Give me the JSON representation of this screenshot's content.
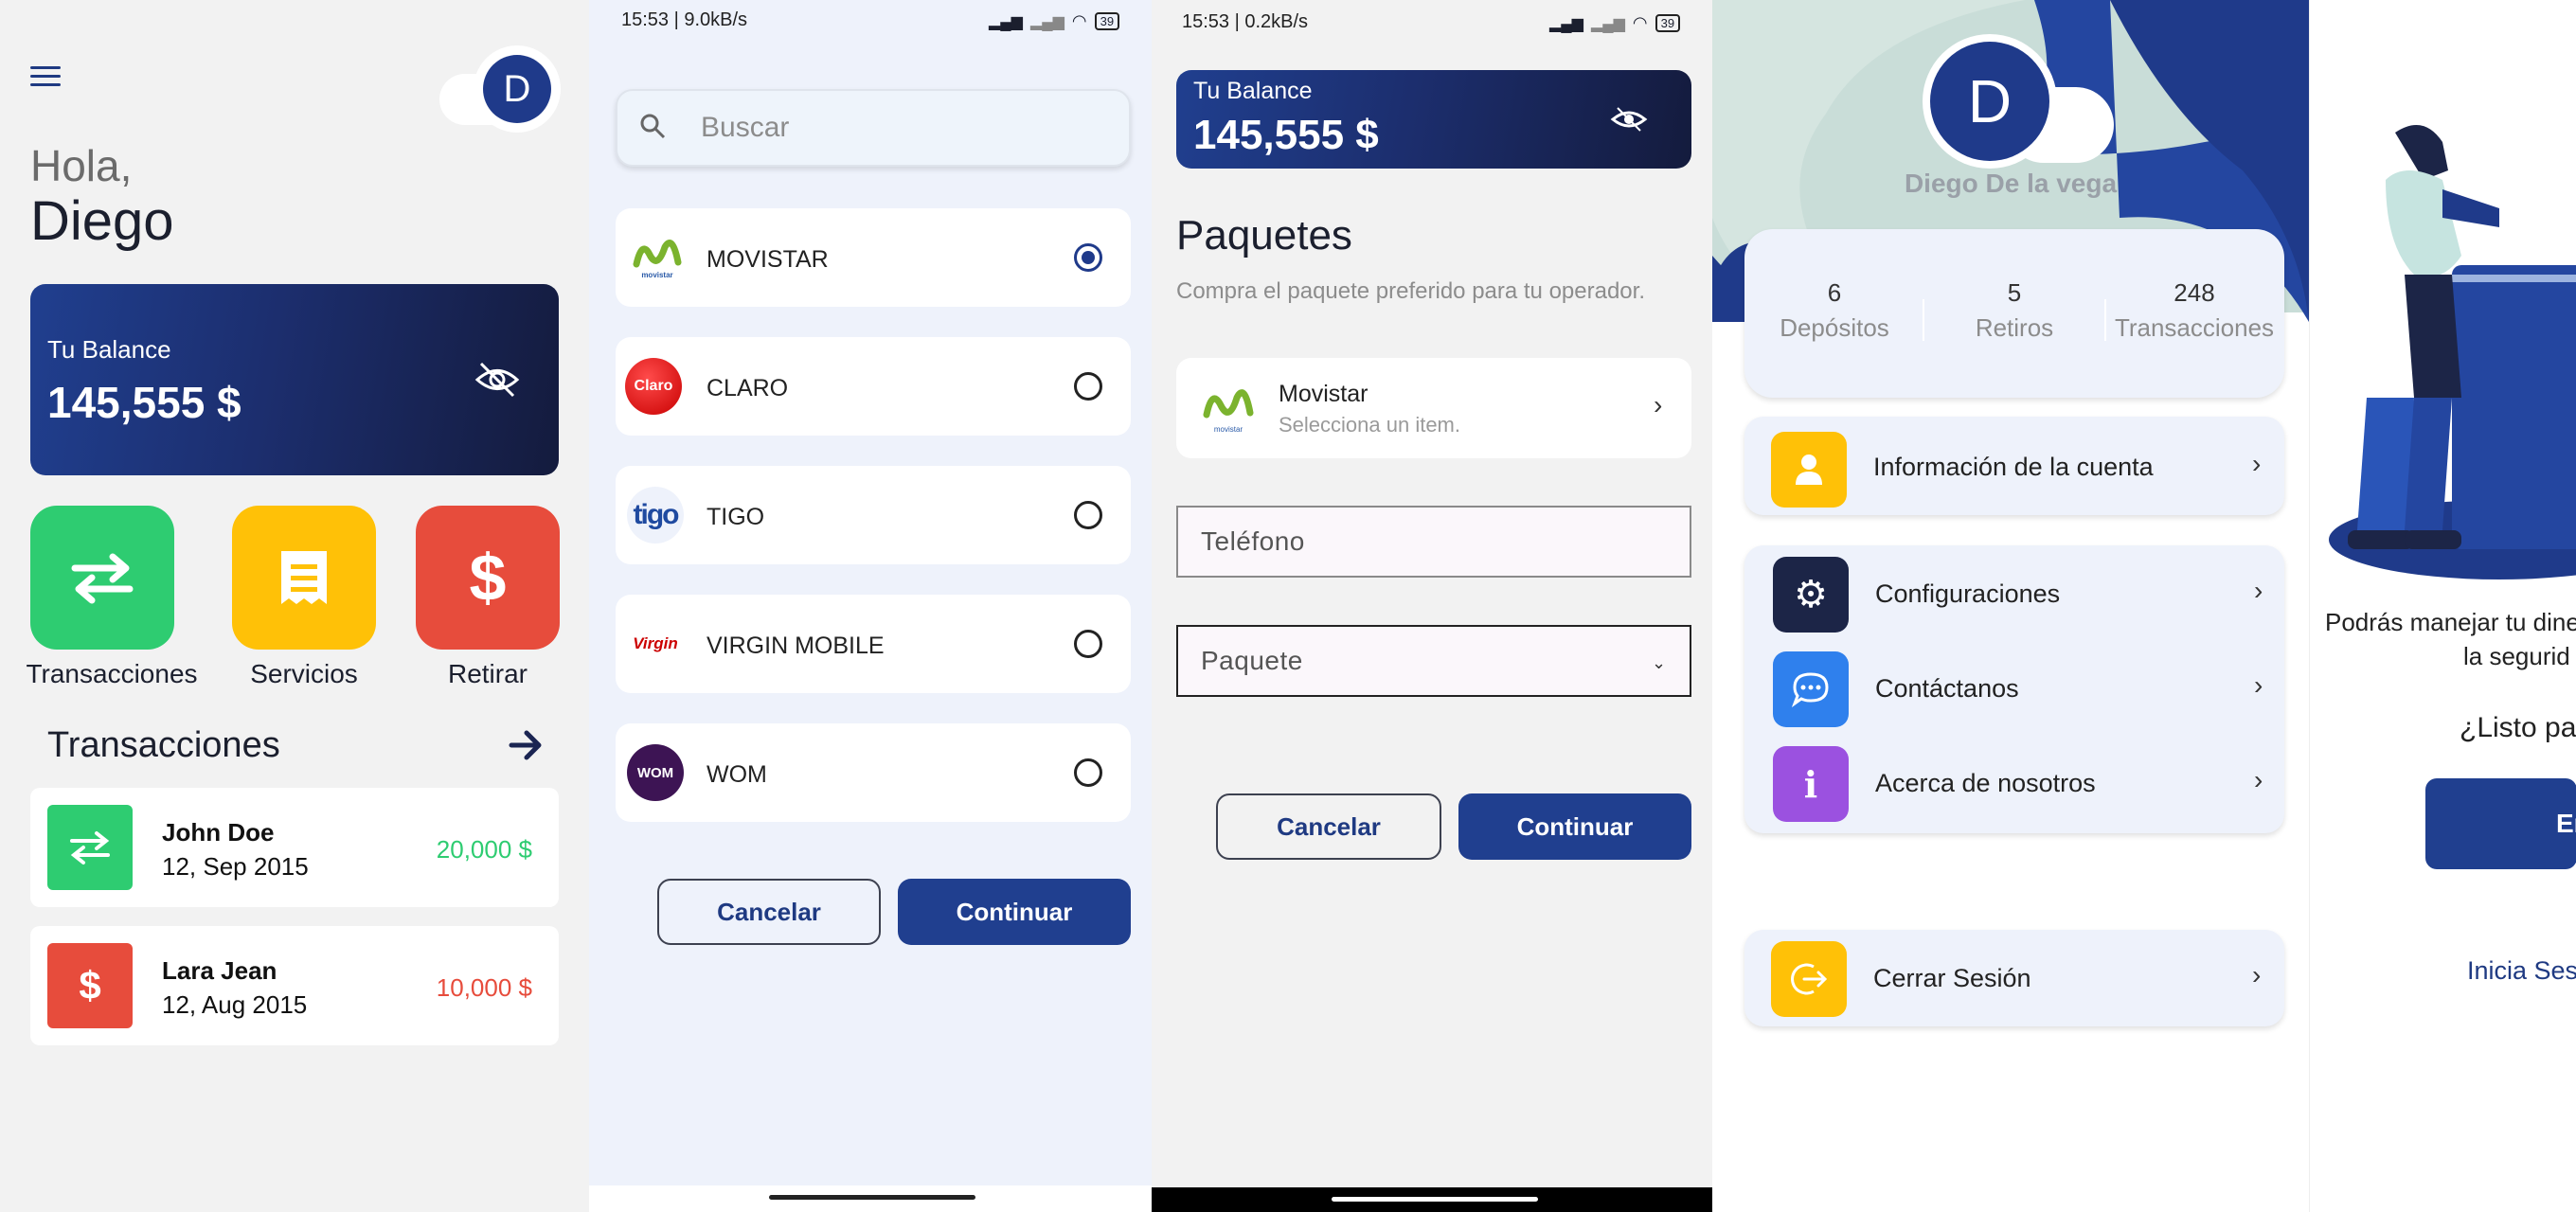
{
  "home": {
    "avatar_initial": "D",
    "greeting": "Hola,",
    "user_name": "Diego",
    "balance_label": "Tu Balance",
    "balance_value": "145,555  $",
    "actions": [
      {
        "label": "Transacciones",
        "icon": "transfer-arrows-icon",
        "color": "#2ecc71"
      },
      {
        "label": "Servicios",
        "icon": "receipt-icon",
        "color": "#ffc107"
      },
      {
        "label": "Retirar",
        "icon": "dollar-icon",
        "color": "#e74c3c"
      }
    ],
    "transactions_title": "Transacciones",
    "transactions": [
      {
        "name": "John Doe",
        "date": "12, Sep 2015",
        "amount": "20,000  $",
        "color": "#2ecc71",
        "icon": "transfer-arrows-icon"
      },
      {
        "name": "Lara Jean",
        "date": "12, Aug 2015",
        "amount": "10,000  $",
        "color": "#e74c3c",
        "icon": "dollar-icon"
      }
    ]
  },
  "operators_screen": {
    "status_time": "15:53 | 9.0kB/s",
    "battery": "39",
    "search_placeholder": "Buscar",
    "operators": [
      {
        "name": "MOVISTAR",
        "selected": true,
        "logo_text": "movistar"
      },
      {
        "name": "CLARO",
        "selected": false,
        "logo_text": "Claro"
      },
      {
        "name": "TIGO",
        "selected": false,
        "logo_text": "tigo"
      },
      {
        "name": "VIRGIN MOBILE",
        "selected": false,
        "logo_text": "Virgin"
      },
      {
        "name": "WOM",
        "selected": false,
        "logo_text": "WOM"
      }
    ],
    "cancel_label": "Cancelar",
    "continue_label": "Continuar"
  },
  "packages_screen": {
    "status_time": "15:53 | 0.2kB/s",
    "battery": "39",
    "balance_label": "Tu Balance",
    "balance_value": "145,555  $",
    "title": "Paquetes",
    "subtitle": "Compra el paquete preferido para tu operador.",
    "operator_name": "Movistar",
    "operator_hint": "Selecciona un item.",
    "phone_label": "Teléfono",
    "package_label": "Paquete",
    "cancel_label": "Cancelar",
    "continue_label": "Continuar"
  },
  "profile_screen": {
    "avatar_initial": "D",
    "name": "Diego De la vega",
    "stats": [
      {
        "value": "6",
        "label": "Depósitos"
      },
      {
        "value": "5",
        "label": "Retiros"
      },
      {
        "value": "248",
        "label": "Transacciones"
      }
    ],
    "menu": [
      {
        "label": "Información de la cuenta",
        "icon": "user-icon",
        "color": "#ffc107"
      },
      {
        "label": "Configuraciones",
        "icon": "gear-icon",
        "color": "#1c2547"
      },
      {
        "label": "Contáctanos",
        "icon": "chat-icon",
        "color": "#2f80ed"
      },
      {
        "label": "Acerca de nosotros",
        "icon": "info-icon",
        "color": "#9b51e0"
      },
      {
        "label": "Cerrar Sesión",
        "icon": "logout-icon",
        "color": "#ffc107"
      }
    ]
  },
  "onboarding_screen": {
    "text_line1": "Podrás manejar tu dine",
    "text_line2": "la segurid",
    "question": "¿Listo pa",
    "button_label": "En",
    "login_link": "Inicia Sesi"
  }
}
